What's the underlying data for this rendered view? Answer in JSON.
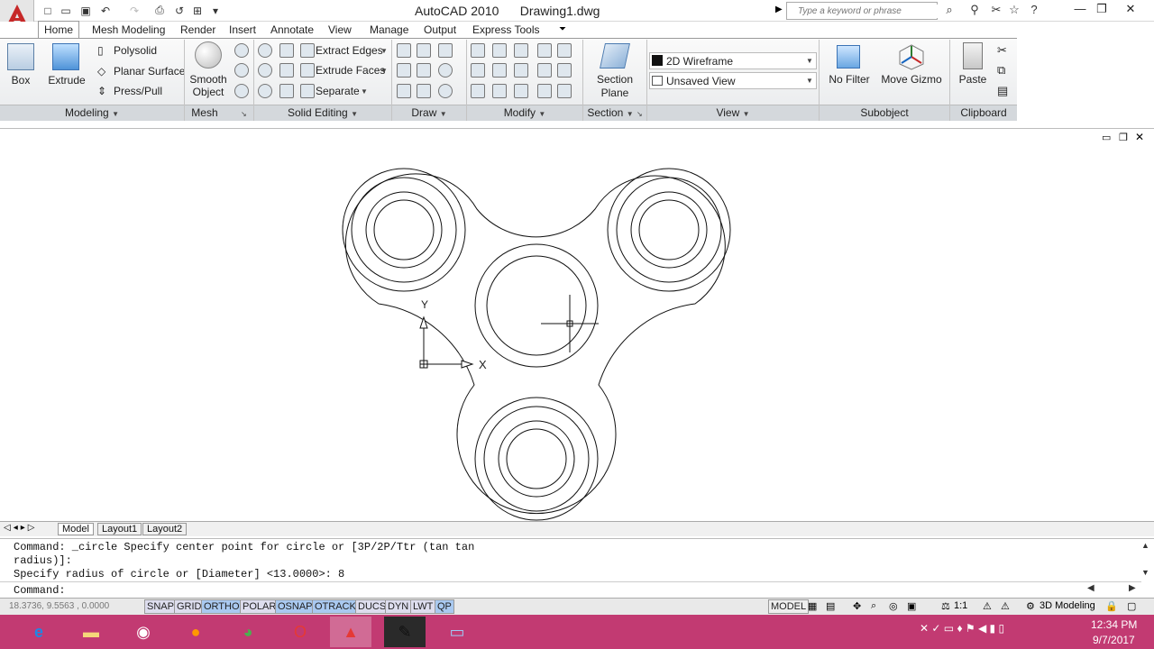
{
  "title": {
    "app": "AutoCAD 2010",
    "file": "Drawing1.dwg"
  },
  "search": {
    "placeholder": "Type a keyword or phrase"
  },
  "tabs": [
    "Home",
    "Mesh Modeling",
    "Render",
    "Insert",
    "Annotate",
    "View",
    "Manage",
    "Output",
    "Express Tools"
  ],
  "panels": {
    "modeling": {
      "title": "Modeling",
      "box": "Box",
      "extrude": "Extrude",
      "polysolid": "Polysolid",
      "planar": "Planar Surface",
      "presspull": "Press/Pull"
    },
    "mesh": {
      "title": "Mesh",
      "smooth": "Smooth",
      "object": "Object"
    },
    "solid": {
      "title": "Solid Editing",
      "extract": "Extract Edges",
      "extrudefaces": "Extrude Faces",
      "separate": "Separate"
    },
    "draw": {
      "title": "Draw"
    },
    "modify": {
      "title": "Modify"
    },
    "section": {
      "title": "Section",
      "plane1": "Section",
      "plane2": "Plane"
    },
    "view": {
      "title": "View",
      "visual": "2D Wireframe",
      "saved": "Unsaved View"
    },
    "subobject": {
      "title": "Subobject",
      "nofilter": "No Filter",
      "gizmo": "Move Gizmo"
    },
    "clipboard": {
      "title": "Clipboard",
      "paste": "Paste"
    }
  },
  "drawing": {
    "ucs_x": "X",
    "ucs_y": "Y"
  },
  "layout_tabs": [
    "Model",
    "Layout1",
    "Layout2"
  ],
  "command": {
    "line1": "Command: _circle Specify center point for circle or [3P/2P/Ttr (tan tan",
    "line2": "radius)]:",
    "line3": "Specify radius of circle or [Diameter] <13.0000>: 8",
    "prompt": "Command:"
  },
  "status": {
    "coords": "18.3736, 9.5563 , 0.0000",
    "toggles": [
      "SNAP",
      "GRID",
      "ORTHO",
      "POLAR",
      "OSNAP",
      "OTRACK",
      "DUCS",
      "DYN",
      "LWT",
      "QP"
    ],
    "model": "MODEL",
    "scale": "1:1",
    "workspace": "3D Modeling"
  },
  "clock": {
    "time": "12:34 PM",
    "date": "9/7/2017"
  }
}
